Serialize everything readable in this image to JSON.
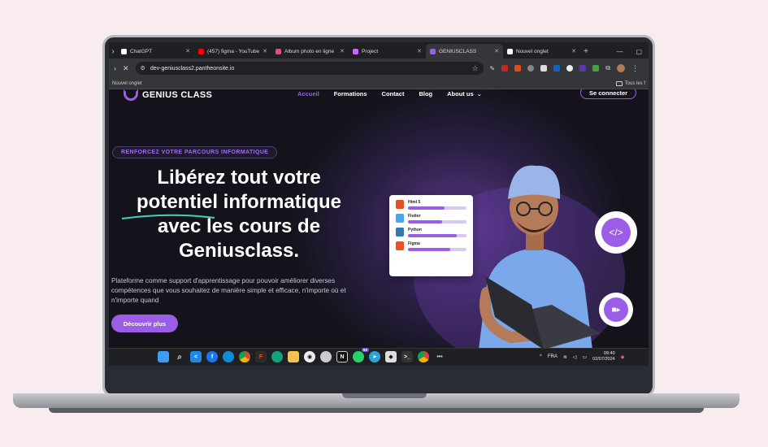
{
  "browser": {
    "tabs": [
      {
        "label": "ChatGPT",
        "favicon_color": "#ffffff",
        "active": false
      },
      {
        "label": "(457) figma - YouTube",
        "favicon_color": "#ff0000",
        "active": false
      },
      {
        "label": "Album photo en ligne",
        "favicon_color": "#e14f7a",
        "active": false
      },
      {
        "label": "Project",
        "favicon_color": "#cc66ff",
        "active": false
      },
      {
        "label": "GENIUSCLASS",
        "favicon_color": "#9b5de5",
        "active": true
      },
      {
        "label": "Nouvel onglet",
        "favicon_color": "#ffffff",
        "active": false
      }
    ],
    "url": "dev-geniusclass2.pantheonsite.io",
    "bookmark_left": "Nouvel onglet",
    "bookmark_right": "Tous les f"
  },
  "site": {
    "logo_text": "GENIUS CLASS",
    "nav": [
      {
        "label": "Accueil",
        "active": true
      },
      {
        "label": "Formations",
        "active": false
      },
      {
        "label": "Contact",
        "active": false
      },
      {
        "label": "Blog",
        "active": false
      },
      {
        "label": "About us",
        "active": false
      }
    ],
    "about_chevron": "⌄",
    "connect_label": "Se connecter",
    "badge": "RENFORCEZ VOTRE PARCOURS INFORMATIQUE",
    "headline_lines": [
      "Libérez tout votre",
      "potentiel informatique",
      "avec les cours de",
      "Geniusclass."
    ],
    "description": "Plateforme comme support d'apprentissage pour pouvoir améliorer diverses compétences que vous souhaitez de manière simple et efficace, n'importe où et n'importe quand",
    "cta_label": "Découvrir plus",
    "skills": [
      {
        "name": "Html 5",
        "color": "#e44d26",
        "level": 0.62
      },
      {
        "name": "Flutter",
        "color": "#42a5f5",
        "level": 0.58
      },
      {
        "name": "Python",
        "color": "#3776ab",
        "level": 0.84
      },
      {
        "name": "Figma",
        "color": "#f24e1e",
        "level": 0.72
      }
    ],
    "accent_color": "#9b5de5"
  },
  "taskbar": {
    "language": "FRA",
    "time": "09:40",
    "date": "02/07/2024",
    "notification_count": "50"
  }
}
